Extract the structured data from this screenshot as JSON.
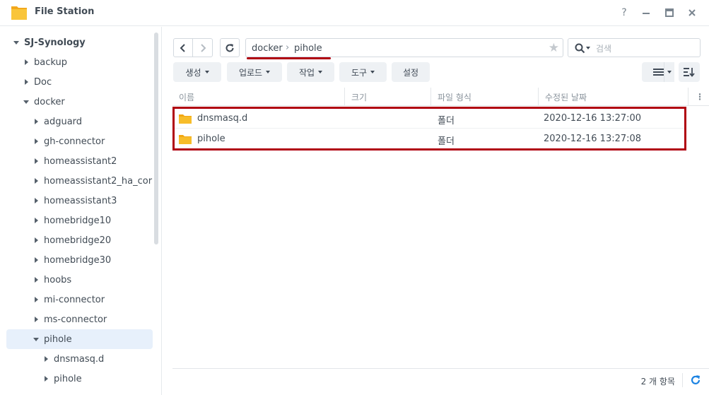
{
  "window": {
    "title": "File Station",
    "help_label": "?",
    "icon": "folder-icon"
  },
  "sidebar": {
    "root": "SJ-Synology",
    "items": [
      {
        "label": "backup",
        "expanded": false
      },
      {
        "label": "Doc",
        "expanded": false
      },
      {
        "label": "docker",
        "expanded": true
      },
      {
        "label": "adguard",
        "expanded": false
      },
      {
        "label": "gh-connector",
        "expanded": false
      },
      {
        "label": "homeassistant2",
        "expanded": false
      },
      {
        "label": "homeassistant2_ha_cor",
        "expanded": false
      },
      {
        "label": "homeassistant3",
        "expanded": false
      },
      {
        "label": "homebridge10",
        "expanded": false
      },
      {
        "label": "homebridge20",
        "expanded": false
      },
      {
        "label": "homebridge30",
        "expanded": false
      },
      {
        "label": "hoobs",
        "expanded": false
      },
      {
        "label": "mi-connector",
        "expanded": false
      },
      {
        "label": "ms-connector",
        "expanded": false
      },
      {
        "label": "pihole",
        "expanded": true,
        "selected": true
      },
      {
        "label": "dnsmasq.d",
        "expanded": false
      },
      {
        "label": "pihole",
        "expanded": false
      }
    ]
  },
  "toolbar": {
    "path": [
      "docker",
      "pihole"
    ],
    "search_placeholder": "검색",
    "buttons": {
      "create": "생성",
      "upload": "업로드",
      "action": "작업",
      "tools": "도구",
      "settings": "설정"
    }
  },
  "columns": {
    "name": "이름",
    "size": "크기",
    "type": "파일 형식",
    "modified": "수정된 날짜"
  },
  "files": [
    {
      "name": "dnsmasq.d",
      "size": "",
      "type": "폴더",
      "modified": "2020-12-16 13:27:00"
    },
    {
      "name": "pihole",
      "size": "",
      "type": "폴더",
      "modified": "2020-12-16 13:27:08"
    }
  ],
  "status": {
    "count": "2 개 항목"
  },
  "colors": {
    "accent": "#1a82e2",
    "highlight": "#b00010",
    "folder": "#f6b41b"
  }
}
